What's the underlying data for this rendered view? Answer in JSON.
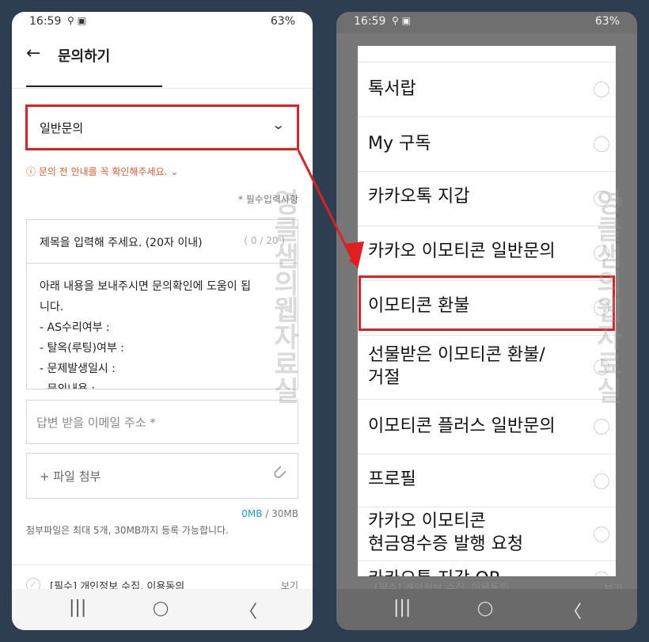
{
  "status_bar": {
    "time": "16:59",
    "notif_icons": "⚲ ▣",
    "signal": "63%"
  },
  "left": {
    "header": {
      "back_glyph": "←",
      "title": "문의하기"
    },
    "category": {
      "value": "일반문의",
      "chevron": "⌄"
    },
    "notice": "ⓘ 문의 전 안내를 꼭 확인해주세요. ⌄",
    "required_note": "* 필수입력사항",
    "subject": {
      "placeholder": "제목을 입력해 주세요. (20자 이내)",
      "counter": "( 0 / 20 )"
    },
    "body_lines": [
      "아래 내용을 보내주시면 문의확인에 도움이 됩",
      "니다.",
      "- AS수리여부 :",
      "- 탈옥(루팅)여부 :",
      "- 문제발생일시 :",
      "- 문의내용 :"
    ],
    "email_placeholder": "답변 받을 이메일 주소 *",
    "attach_label": "+ 파일 첨부",
    "size_used": "0MB",
    "size_total": " / 30MB",
    "attach_info": "첨부파일은 최대 5개, 30MB까지 등록 가능합니다.",
    "agreement": {
      "label": "[필수] 개인정보 수집, 이용동의",
      "view": "보기"
    }
  },
  "nav": {
    "recent": "|||",
    "home": "◯",
    "back": "〈"
  },
  "right": {
    "options": [
      "톡서랍",
      "My 구독",
      "카카오톡 지갑",
      "카카오 이모티콘 일반문의",
      "이모티콘 환불",
      "선물받은 이모티콘 환불/\n거절",
      "이모티콘 플러스 일반문의",
      "프로필",
      "카카오 이모티콘\n현금영수증 발행 요청",
      "카카오톡 지갑 QR"
    ],
    "highlighted_index": 4,
    "behind_agreement": "[필수] 개인정보 수집, 이용동의",
    "behind_view": "보기",
    "behind_required": "사항"
  },
  "watermark": {
    "text": "영클샘의웹자료실"
  },
  "colors": {
    "highlight": "#e02020",
    "notice": "#e15b2c",
    "accent": "#1aa0d8"
  }
}
